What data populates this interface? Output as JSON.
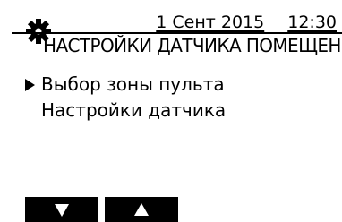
{
  "header": {
    "icon": "gear-icon",
    "date": "1 Сент 2015",
    "time": "12:30",
    "title": "НАСТРОЙКИ ДАТЧИКА ПОМЕЩЕНИЯ"
  },
  "menu": {
    "items": [
      {
        "label": "Выбор зоны пульта",
        "selected": true
      },
      {
        "label": "Настройки датчика",
        "selected": false
      }
    ]
  },
  "softkeys": [
    {
      "icon": "arrow-down-icon"
    },
    {
      "icon": "arrow-up-icon"
    }
  ]
}
